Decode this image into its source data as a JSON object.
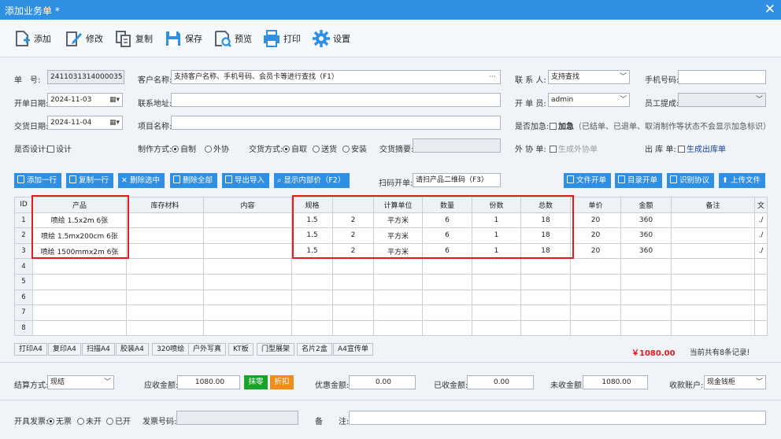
{
  "window": {
    "title": "添加业务单 *",
    "close": "✕"
  },
  "toolbar": [
    {
      "label": "添加",
      "icon": "add-doc-icon"
    },
    {
      "label": "修改",
      "icon": "edit-icon"
    },
    {
      "label": "复制",
      "icon": "copy-icon"
    },
    {
      "label": "保存",
      "icon": "save-icon"
    },
    {
      "label": "预览",
      "icon": "preview-icon"
    },
    {
      "label": "打印",
      "icon": "print-icon"
    },
    {
      "label": "设置",
      "icon": "gear-icon"
    }
  ],
  "form": {
    "order_no_label": "单　号:",
    "order_no": "2411031314000035",
    "customer_label": "客户名称:",
    "customer_placeholder": "支持客户名称、手机号码、会员卡等进行查找（F1）",
    "customer_more": "···",
    "contact_label": "联 系 人:",
    "contact_value": "支持查找",
    "phone_label": "手机号码:",
    "phone_value": "",
    "open_date_label": "开单日期:",
    "open_date": "2024-11-03",
    "address_label": "联系地址:",
    "address_value": "",
    "clerk_label": "开 单 员:",
    "clerk_value": "admin",
    "commission_label": "员工提成:",
    "commission_value": "",
    "delivery_date_label": "交货日期:",
    "delivery_date": "2024-11-04",
    "project_label": "项目名称:",
    "project_value": "",
    "urgent_label": "是否加急:",
    "urgent_option": "加急",
    "urgent_note": "（已结单、已退单、取消制作等状态不会显示加急标识）",
    "design_label": "是否设计:",
    "design_option": "设计",
    "make_label": "制作方式:",
    "make_options": [
      "自制",
      "外协"
    ],
    "deliver_label": "交货方式:",
    "deliver_options": [
      "自取",
      "送货",
      "安装"
    ],
    "summary_label": "交货摘要:",
    "summary_value": "",
    "outsource_label": "外 协 单:",
    "outsource_option": "生成外协单",
    "stockout_label": "出 库 单:",
    "stockout_option": "生成出库单"
  },
  "row_buttons": [
    "添加一行",
    "复制一行",
    "删除选中",
    "删除全部",
    "导出导入",
    "显示内部价（F2）"
  ],
  "scan_label": "扫码开单:",
  "scan_placeholder": "请扫产品二维码（F3）",
  "right_buttons": [
    "文件开单",
    "目录开单",
    "识别协议",
    "上传文件"
  ],
  "table": {
    "headers": [
      "ID",
      "产品",
      "库存材料",
      "内容",
      "规格",
      "",
      "计算单位",
      "数量",
      "份数",
      "总数",
      "单价",
      "金额",
      "备注",
      "文"
    ],
    "rows": [
      [
        "1",
        "喷绘 1.5x2m 6张",
        "",
        "",
        "1.5",
        "2",
        "平方米",
        "6",
        "1",
        "18",
        "20",
        "360",
        "",
        "./"
      ],
      [
        "2",
        "喷绘 1.5mx200cm 6张",
        "",
        "",
        "1.5",
        "2",
        "平方米",
        "6",
        "1",
        "18",
        "20",
        "360",
        "",
        "./"
      ],
      [
        "3",
        "喷绘 1500mmx2m 6张",
        "",
        "",
        "1.5",
        "2",
        "平方米",
        "6",
        "1",
        "18",
        "20",
        "360",
        "",
        "./"
      ],
      [
        "4",
        "",
        "",
        "",
        "",
        "",
        "",
        "",
        "",
        "",
        "",
        "",
        "",
        ""
      ],
      [
        "5",
        "",
        "",
        "",
        "",
        "",
        "",
        "",
        "",
        "",
        "",
        "",
        "",
        ""
      ],
      [
        "6",
        "",
        "",
        "",
        "",
        "",
        "",
        "",
        "",
        "",
        "",
        "",
        "",
        ""
      ],
      [
        "7",
        "",
        "",
        "",
        "",
        "",
        "",
        "",
        "",
        "",
        "",
        "",
        "",
        ""
      ],
      [
        "8",
        "",
        "",
        "",
        "",
        "",
        "",
        "",
        "",
        "",
        "",
        "",
        "",
        ""
      ]
    ]
  },
  "presets": [
    "打印A4",
    "复印A4",
    "扫描A4",
    "胶装A4",
    "320喷绘",
    "户外写真",
    "KT板",
    "门型展架",
    "名片2盒",
    "A4宣传单"
  ],
  "total": "￥1080.00",
  "record_count": "当前共有8条记录!",
  "payment": {
    "method_label": "结算方式:",
    "method_value": "现结",
    "receivable_label": "应收金额:",
    "receivable": "1080.00",
    "round_btn": "抹零",
    "discount_btn": "折扣",
    "discount_label": "优惠金额:",
    "discount": "0.00",
    "received_label": "已收金额:",
    "received": "0.00",
    "unpaid_label": "未收金额:",
    "unpaid": "1080.00",
    "account_label": "收款账户:",
    "account_value": "现金钱柜"
  },
  "invoice": {
    "label": "开具发票:",
    "options": [
      "无票",
      "未开",
      "已开"
    ],
    "no_label": "发票号码:",
    "no_value": "",
    "remark_label": "备　　注:",
    "remark_value": ""
  },
  "colors": {
    "title_bar": "#2f8fe3",
    "button": "#2f8fe3",
    "highlight_box": "#e21b1b",
    "total": "#e21b1b",
    "round_btn": "#1aa32a",
    "discount_btn": "#f08c1a"
  }
}
